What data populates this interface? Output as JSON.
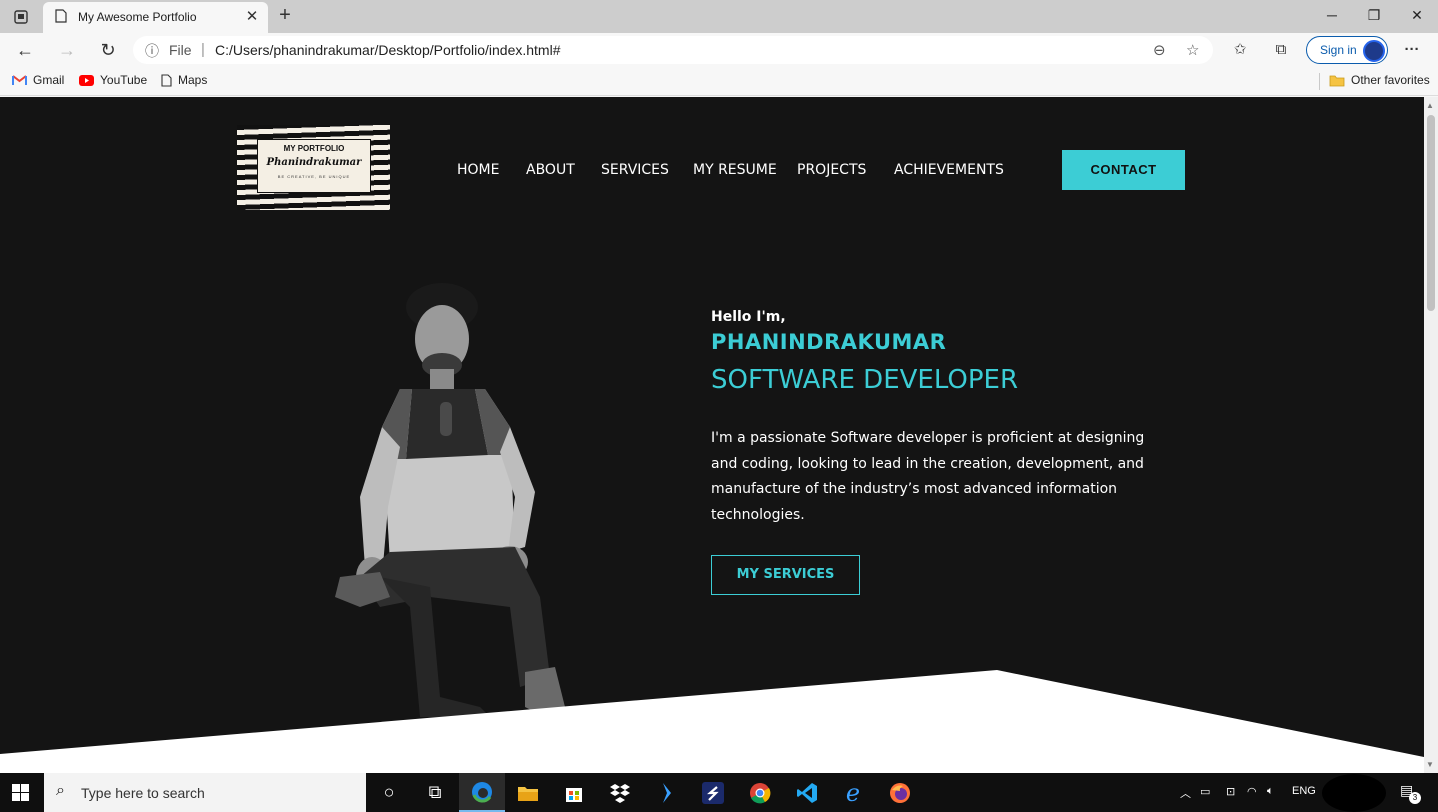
{
  "browser": {
    "tab_title": "My Awesome Portfolio",
    "url_prefix": "File",
    "url": "C:/Users/phanindrakumar/Desktop/Portfolio/index.html#",
    "sign_in_label": "Sign in",
    "bookmarks": [
      "Gmail",
      "YouTube",
      "Maps"
    ],
    "other_favorites": "Other favorites"
  },
  "site": {
    "logo": {
      "title": "MY PORTFOLIO",
      "name": "Phanindrakumar",
      "tagline": "BE CREATIVE, BE UNIQUE"
    },
    "nav": [
      "HOME",
      "ABOUT",
      "SERVICES",
      "MY RESUME",
      "PROJECTS",
      "ACHIEVEMENTS"
    ],
    "contact_label": "CONTACT",
    "hero": {
      "greeting": "Hello I'm,",
      "name": "PHANINDRAKUMAR",
      "role": "SOFTWARE DEVELOPER",
      "description": "I'm a passionate Software developer is proficient at designing and coding, looking to lead in the creation, development, and manufacture of the industry’s most advanced information technologies.",
      "cta_label": "MY SERVICES"
    },
    "colors": {
      "accent": "#3ccdd5",
      "background": "#141414"
    }
  },
  "taskbar": {
    "search_placeholder": "Type here to search",
    "language": "ENG",
    "notification_count": "3"
  }
}
